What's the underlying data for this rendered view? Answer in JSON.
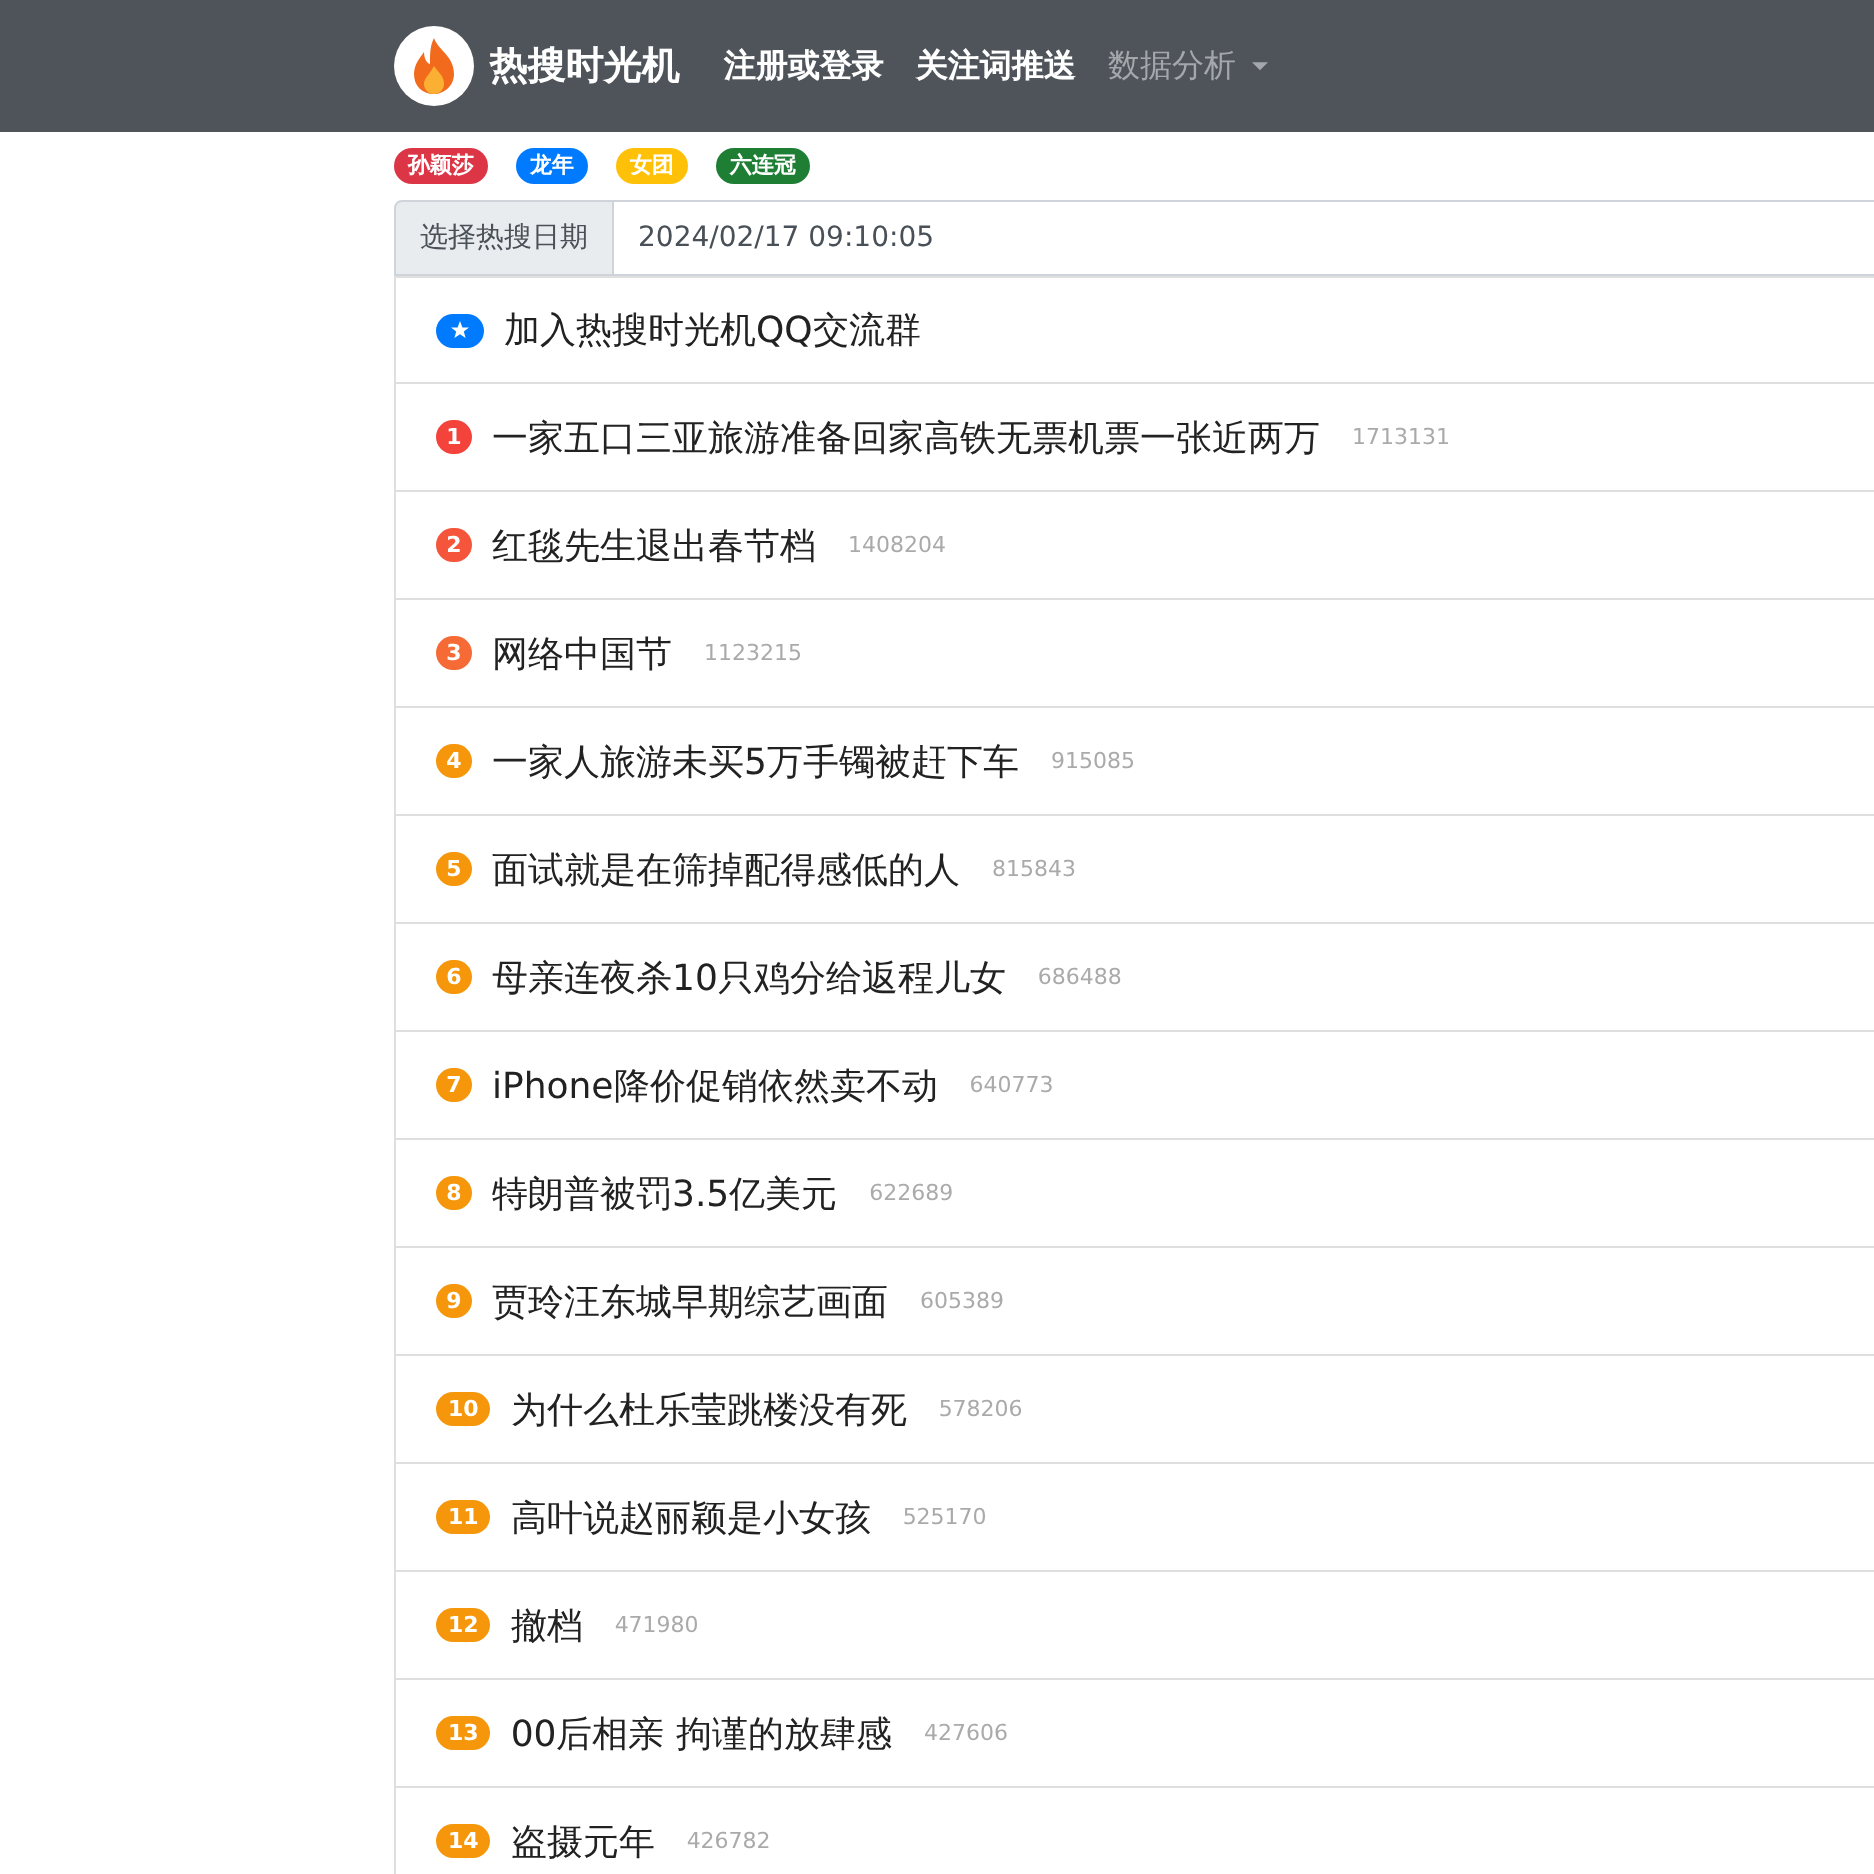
{
  "navbar": {
    "brand": "热搜时光机",
    "links": [
      {
        "label": "注册或登录",
        "kind": "link",
        "disabled": false
      },
      {
        "label": "关注词推送",
        "kind": "link",
        "disabled": false
      },
      {
        "label": "数据分析",
        "kind": "dropdown",
        "disabled": true
      }
    ]
  },
  "tags": [
    {
      "label": "孙颖莎",
      "color": "#dc3545"
    },
    {
      "label": "龙年",
      "color": "#007bff"
    },
    {
      "label": "女团",
      "color": "#ffc107"
    },
    {
      "label": "六连冠",
      "color": "#1e7e34"
    }
  ],
  "date_picker": {
    "label": "选择热搜日期",
    "value": "2024/02/17 09:10:05"
  },
  "list": [
    {
      "kind": "pinned",
      "title": "加入热搜时光机QQ交流群",
      "color": "#007bff"
    },
    {
      "kind": "ranked",
      "rank": "1",
      "title": "一家五口三亚旅游准备回家高铁无票机票一张近两万",
      "count": "1713131",
      "color": "#f4433b"
    },
    {
      "kind": "ranked",
      "rank": "2",
      "title": "红毯先生退出春节档",
      "count": "1408204",
      "color": "#f5553b"
    },
    {
      "kind": "ranked",
      "rank": "3",
      "title": "网络中国节",
      "count": "1123215",
      "color": "#f56a35"
    },
    {
      "kind": "ranked",
      "rank": "4",
      "title": "一家人旅游未买5万手镯被赶下车",
      "count": "915085",
      "color": "#f5960b"
    },
    {
      "kind": "ranked",
      "rank": "5",
      "title": "面试就是在筛掉配得感低的人",
      "count": "815843",
      "color": "#f5960b"
    },
    {
      "kind": "ranked",
      "rank": "6",
      "title": "母亲连夜杀10只鸡分给返程儿女",
      "count": "686488",
      "color": "#f5960b"
    },
    {
      "kind": "ranked",
      "rank": "7",
      "title": "iPhone降价促销依然卖不动",
      "count": "640773",
      "color": "#f5960b"
    },
    {
      "kind": "ranked",
      "rank": "8",
      "title": "特朗普被罚3.5亿美元",
      "count": "622689",
      "color": "#f5960b"
    },
    {
      "kind": "ranked",
      "rank": "9",
      "title": "贾玲汪东城早期综艺画面",
      "count": "605389",
      "color": "#f5960b"
    },
    {
      "kind": "ranked",
      "rank": "10",
      "title": "为什么杜乐莹跳楼没有死",
      "count": "578206",
      "color": "#f5960b"
    },
    {
      "kind": "ranked",
      "rank": "11",
      "title": "高叶说赵丽颖是小女孩",
      "count": "525170",
      "color": "#f5960b"
    },
    {
      "kind": "ranked",
      "rank": "12",
      "title": "撤档",
      "count": "471980",
      "color": "#f5960b"
    },
    {
      "kind": "ranked",
      "rank": "13",
      "title": "00后相亲 拘谨的放肆感",
      "count": "427606",
      "color": "#f5960b"
    },
    {
      "kind": "ranked",
      "rank": "14",
      "title": "盗摄元年",
      "count": "426782",
      "color": "#f5960b"
    }
  ]
}
